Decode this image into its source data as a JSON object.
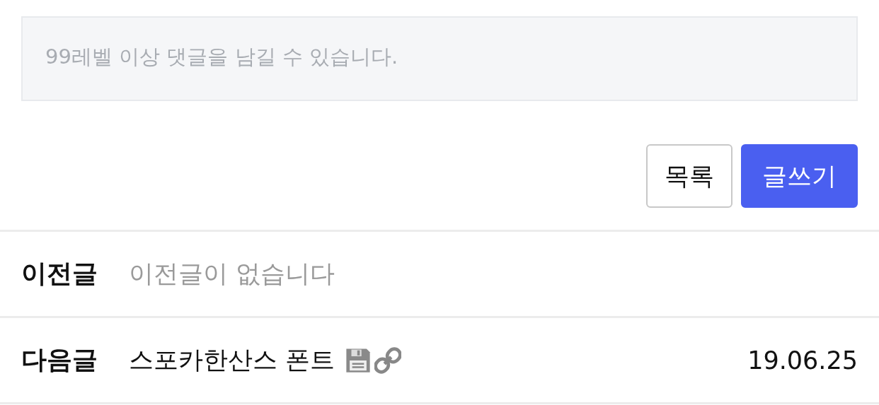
{
  "comment_box": {
    "placeholder": "99레벨 이상 댓글을 남길 수 있습니다."
  },
  "buttons": [
    {
      "label": "목록",
      "kind": "secondary"
    },
    {
      "label": "글쓰기",
      "kind": "primary"
    }
  ],
  "post_nav": [
    {
      "label": "이전글",
      "title": "이전글이 없습니다",
      "empty": true
    },
    {
      "label": "다음글",
      "title": "스포카한산스 폰트",
      "empty": false,
      "has_file": true,
      "has_link": true,
      "date": "19.06.25"
    }
  ]
}
